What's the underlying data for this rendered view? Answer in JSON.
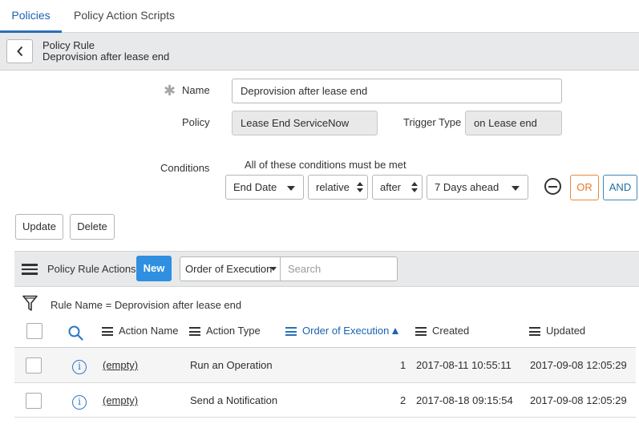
{
  "tabs": [
    {
      "label": "Policies",
      "active": true
    },
    {
      "label": "Policy Action Scripts",
      "active": false
    }
  ],
  "header": {
    "record_type": "Policy Rule",
    "record_name": "Deprovision after lease end",
    "back_icon": "chevron-left-icon"
  },
  "form": {
    "name_label": "Name",
    "name_value": "Deprovision after lease end",
    "policy_label": "Policy",
    "policy_value": "Lease End ServiceNow",
    "trigger_label": "Trigger Type",
    "trigger_value": "on Lease end",
    "conditions_label": "Conditions",
    "conditions_note": "All of these conditions must be met",
    "condition": {
      "field": "End Date",
      "mode": "relative",
      "operator": "after",
      "value": "7 Days ahead"
    },
    "or_label": "OR",
    "and_label": "AND",
    "update_label": "Update",
    "delete_label": "Delete"
  },
  "related_list": {
    "title": "Policy Rule Actions",
    "new_label": "New",
    "sort_select": "Order of Execution",
    "search_placeholder": "Search",
    "filter_text": "Rule Name = Deprovision after lease end",
    "columns": [
      "Action Name",
      "Action Type",
      "Order of Execution",
      "Created",
      "Updated"
    ],
    "sorted_column": "Order of Execution",
    "rows": [
      {
        "action_name": "(empty)",
        "action_type": "Run an Operation",
        "order": "1",
        "created": "2017-08-11 10:55:11",
        "updated": "2017-09-08 12:05:29"
      },
      {
        "action_name": "(empty)",
        "action_type": "Send a Notification",
        "order": "2",
        "created": "2017-08-18 09:15:54",
        "updated": "2017-09-08 12:05:29"
      }
    ]
  },
  "colors": {
    "active_tab": "#1a63b1",
    "new_button": "#2f8fe0",
    "or_button": "#e67a2a",
    "and_button": "#1d6fa3"
  }
}
